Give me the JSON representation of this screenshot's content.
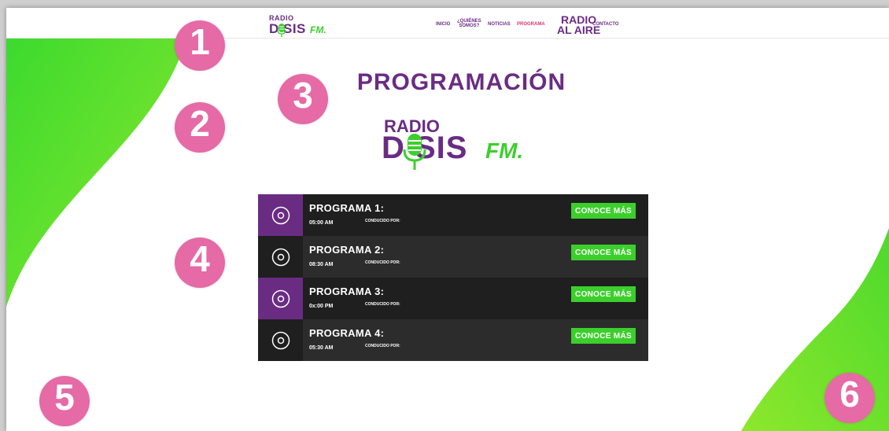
{
  "logo": {
    "radio": "RADIO",
    "dosis": "D SIS",
    "fm": "FM."
  },
  "nav": {
    "inicio": "INICIO",
    "quienes_line1": "¿QUIÉNES",
    "quienes_line2": "SOMOS?",
    "noticias": "NOTICIAS",
    "programa": "PROGRAMA",
    "radio_line1": "RADIO",
    "radio_line2": "AL AIRE",
    "contacto": "CONTACTO"
  },
  "page_title": "PROGRAMACIÓN",
  "schedule": [
    {
      "name": "PROGRAMA 1:",
      "time": "05:00 AM",
      "host_label": "CONDUCIDO POR:",
      "button": "CONOCE MÁS"
    },
    {
      "name": "PROGRAMA 2:",
      "time": "08:30 AM",
      "host_label": "CONDUCIDO POR:",
      "button": "CONOCE MÁS"
    },
    {
      "name": "PROGRAMA 3:",
      "time": "0x:00 PM",
      "host_label": "CONDUCIDO POR:",
      "button": "CONOCE MÁS"
    },
    {
      "name": "PROGRAMA 4:",
      "time": "05:30 AM",
      "host_label": "CONDUCIDO POR:",
      "button": "CONOCE MÁS"
    }
  ],
  "annotations": [
    "1",
    "2",
    "3",
    "4",
    "5",
    "6"
  ],
  "icons": {
    "row_icon": "disc-icon",
    "logo_icon": "microphone-icon"
  },
  "colors": {
    "purple": "#6a2c83",
    "green": "#3ccf2c",
    "pink_badge": "#e56aa6",
    "active_nav": "#e0336e"
  }
}
